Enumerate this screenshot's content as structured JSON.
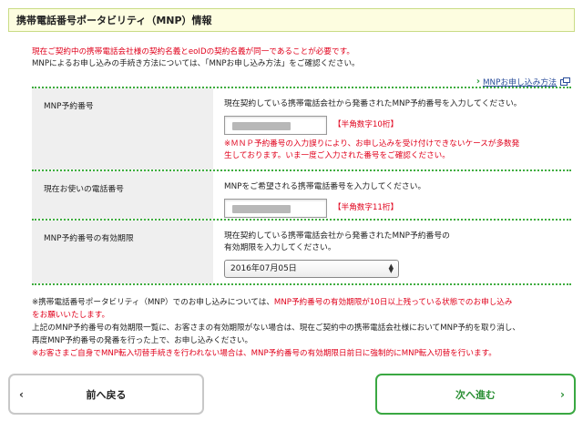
{
  "header": {
    "title": "携帯電話番号ポータビリティ（MNP）情報"
  },
  "intro": {
    "line1": "現在ご契約中の携帯電話会社様の契約名義とeoIDの契約名義が同一であることが必要です。",
    "line2": "MNPによるお申し込みの手続き方法については、「MNPお申し込み方法」をご確認ください。"
  },
  "mnp_link": {
    "label": "MNPお申し込み方法",
    "icon": "external-link-icon"
  },
  "form": {
    "mnp_number": {
      "label": "MNP予約番号",
      "instruction": "現在契約している携帯電話会社から発番されたMNP予約番号を入力してください。",
      "value": "",
      "hint": "【半角数字10桁】",
      "note1": "※ＭＮＰ予約番号の入力誤りにより、お申し込みを受け付けできないケースが多数発",
      "note2": "生しております。いま一度ご入力された番号をご確認ください。"
    },
    "phone_number": {
      "label": "現在お使いの電話番号",
      "instruction": "MNPをご希望される携帯電話番号を入力してください。",
      "value": "",
      "hint": "【半角数字11桁】"
    },
    "expiry": {
      "label": "MNP予約番号の有効期限",
      "instruction1": "現在契約している携帯電話会社から発番されたMNP予約番号の",
      "instruction2": "有効期限を入力してください。",
      "selected": "2016年07月05日"
    }
  },
  "footnotes": {
    "f1_black": "※携帯電話番号ポータビリティ（MNP）でのお申し込みについては、",
    "f1_red": "MNP予約番号の有効期限が10日以上残っている状態でのお申し込み",
    "f1_red2": "をお願いいたします。",
    "f2": "上記のMNP予約番号の有効期限一覧に、お客さまの有効期限がない場合は、現在ご契約中の携帯電話会社様においてMNP予約を取り消し、",
    "f3": "再度MNP予約番号の発番を行った上で、お申し込みください。",
    "f4": "※お客さまご自身でMNP転入切替手続きを行われない場合は、MNP予約番号の有効期限日前日に強制的にMNP転入切替を行います。"
  },
  "buttons": {
    "back": "前へ戻る",
    "next": "次へ進む"
  },
  "colors": {
    "accent_green": "#3aa842",
    "alert_red": "#e0001b",
    "header_bg": "#fdfde0",
    "link_blue": "#2a4d9a"
  }
}
